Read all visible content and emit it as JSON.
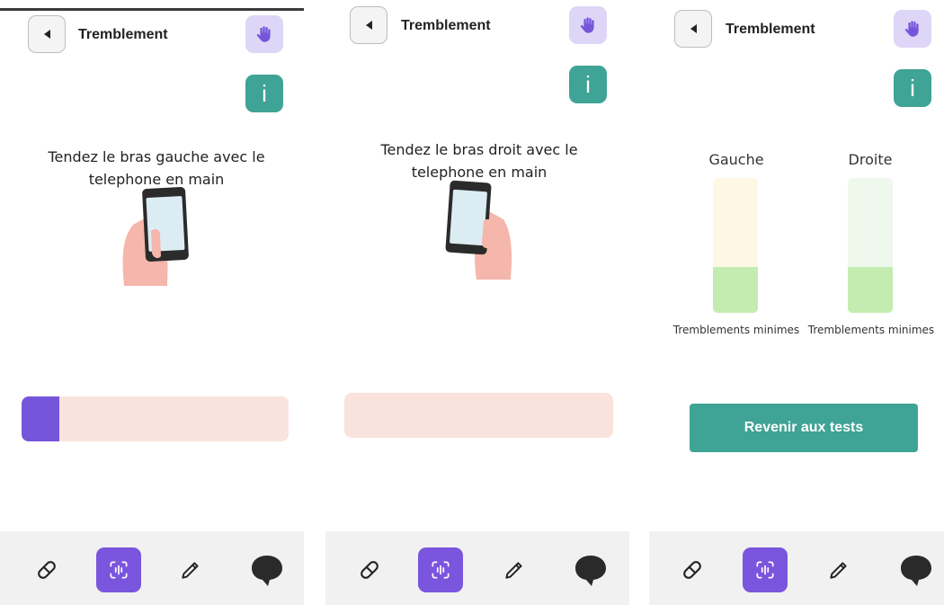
{
  "screens": [
    {
      "header": {
        "title": "Tremblement"
      },
      "instruction": "Tendez le bras gauche avec le telephone en main",
      "progress": 0.14
    },
    {
      "header": {
        "title": "Tremblement"
      },
      "instruction": "Tendez le bras droit avec le telephone en main",
      "progress": 0
    },
    {
      "header": {
        "title": "Tremblement"
      },
      "results": {
        "left": {
          "label": "Gauche",
          "level": 0.34,
          "status": "Tremblements minimes",
          "track_color": "#fef7e6"
        },
        "right": {
          "label": "Droite",
          "level": 0.34,
          "status": "Tremblements minimes",
          "track_color": "#eef8ec"
        }
      },
      "back_to_tests_label": "Revenir aux tests"
    }
  ],
  "icons": {
    "back": "back-arrow-icon",
    "hand": "hand-icon",
    "info": "info-icon",
    "nav": [
      "pill-icon",
      "tremor-scan-icon",
      "pencil-icon",
      "chat-bubble-icon"
    ]
  },
  "colors": {
    "accent": "#7556db",
    "teal": "#3fa395",
    "progress_track": "#fae3dc",
    "gauge_fill": "#c5ecb0",
    "hand_button_bg": "#ddd6f7"
  }
}
